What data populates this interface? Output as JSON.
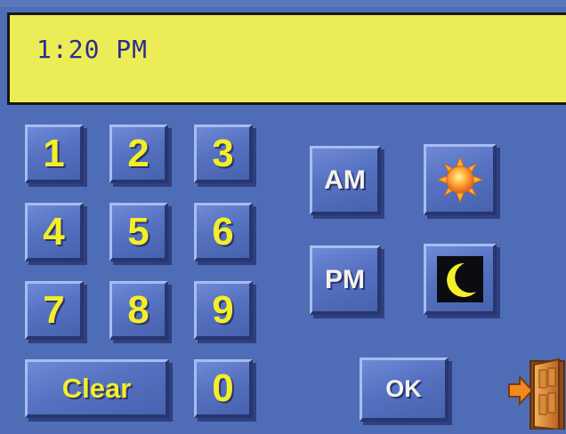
{
  "display": {
    "time": "1:20 PM"
  },
  "keypad": {
    "keys": [
      "1",
      "2",
      "3",
      "4",
      "5",
      "6",
      "7",
      "8",
      "9"
    ],
    "clear_label": "Clear",
    "zero_label": "0"
  },
  "period": {
    "am_label": "AM",
    "pm_label": "PM"
  },
  "icons": {
    "am": "sun-icon",
    "pm": "moon-icon",
    "exit": "exit-door-icon"
  },
  "actions": {
    "ok_label": "OK"
  },
  "colors": {
    "background": "#4f6db6",
    "display_background": "#ecec57",
    "display_text": "#2b2f88",
    "key_text": "#f2ee2a",
    "button_face": "#5571c0"
  }
}
